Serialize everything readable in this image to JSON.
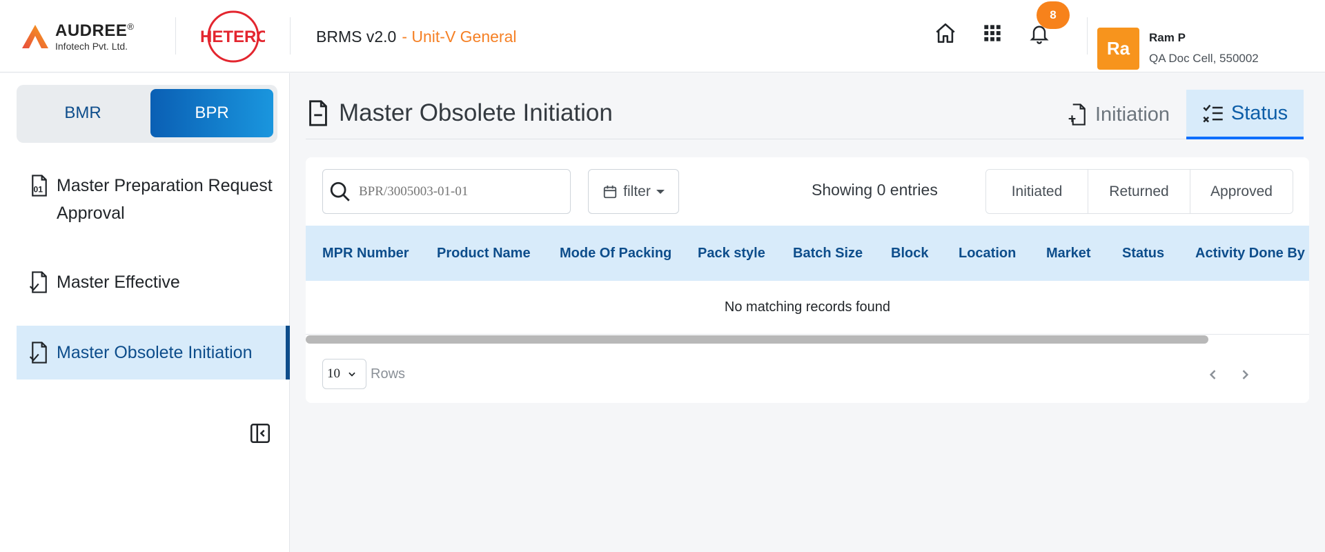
{
  "header": {
    "brand_name": "AUDREE",
    "brand_sub": "Infotech Pvt. Ltd.",
    "partner_logo_text": "HETERO",
    "app_version": "BRMS v2.0",
    "unit": "- Unit-V General",
    "notification_count": "8",
    "user": {
      "initials": "Ra",
      "name": "Ram P",
      "role": "QA Doc Cell, 550002"
    },
    "icons": [
      "home-icon",
      "apps-grid-icon",
      "bell-icon"
    ]
  },
  "sidebar": {
    "toggle": {
      "bmr": "BMR",
      "bpr": "BPR",
      "selected": "BPR"
    },
    "items": [
      {
        "label": "Master Preparation Request Approval",
        "icon": "file-binary-icon"
      },
      {
        "label": "Master Effective",
        "icon": "file-check-icon"
      },
      {
        "label": "Master Obsolete Initiation",
        "icon": "file-check-icon",
        "active": true
      }
    ]
  },
  "main": {
    "title": "Master Obsolete Initiation",
    "tabs": [
      {
        "label": "Initiation",
        "icon": "file-plus-icon"
      },
      {
        "label": "Status",
        "icon": "checklist-icon",
        "active": true
      }
    ],
    "search": {
      "placeholder": "BPR/3005003-01-01"
    },
    "filter_label": "filter",
    "entries_text": "Showing 0 entries",
    "status_filters": [
      "Initiated",
      "Returned",
      "Approved"
    ],
    "columns": [
      "MPR Number",
      "Product Name",
      "Mode Of Packing",
      "Pack style",
      "Batch Size",
      "Block",
      "Location",
      "Market",
      "Status",
      "Activity Done By"
    ],
    "empty_message": "No matching records found",
    "rows_per_page": "10",
    "rows_label": "Rows"
  },
  "colors": {
    "accent": "#0d4d8b",
    "orange": "#f7821b",
    "highlight": "#d8ebfa"
  }
}
